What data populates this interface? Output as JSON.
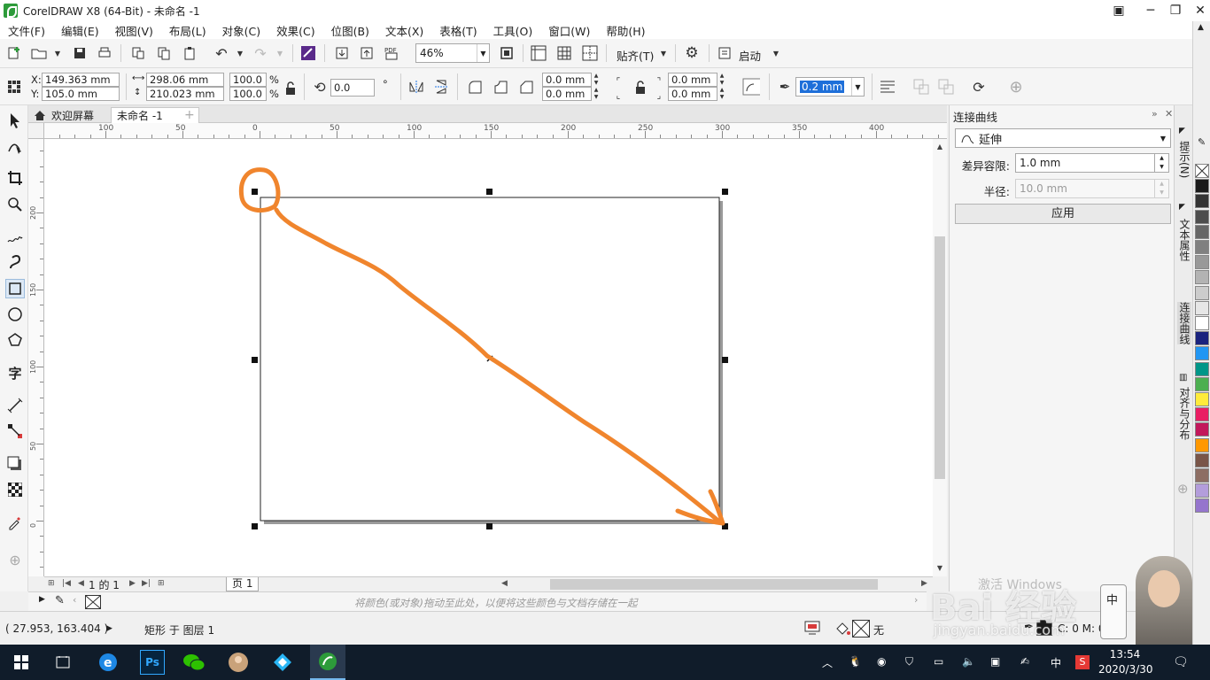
{
  "window": {
    "title": "CorelDRAW X8 (64-Bit) - 未命名 -1",
    "min": "─",
    "max": "❐",
    "close": "✕",
    "restore": "▣"
  },
  "menu": [
    "文件(F)",
    "编辑(E)",
    "视图(V)",
    "布局(L)",
    "对象(C)",
    "效果(C)",
    "位图(B)",
    "文本(X)",
    "表格(T)",
    "工具(O)",
    "窗口(W)",
    "帮助(H)"
  ],
  "toolbar": {
    "zoom": "46%",
    "snap": "贴齐(T)",
    "launch": "启动"
  },
  "property_bar": {
    "x_label": "X:",
    "x": "149.363 mm",
    "y_label": "Y:",
    "y": "105.0 mm",
    "width": "298.06 mm",
    "height": "210.023 mm",
    "scale_w": "100.0",
    "scale_h": "100.0",
    "percent": "%",
    "rotation": "0.0",
    "degree": "°",
    "corner1": "0.0 mm",
    "corner2": "0.0 mm",
    "corner3": "0.0 mm",
    "corner4": "0.0 mm",
    "outline": "0.2 mm"
  },
  "tabs": {
    "welcome": "欢迎屏幕",
    "document": "未命名 -1",
    "add": "+"
  },
  "ruler": {
    "h_labels": [
      "100",
      "50",
      "0",
      "50",
      "100",
      "150",
      "200",
      "250",
      "300",
      "350",
      "400"
    ],
    "v_labels": [
      "200",
      "150",
      "100",
      "50",
      "0"
    ]
  },
  "page_nav": {
    "page_count": "1 的 1",
    "page_tab": "页 1"
  },
  "palette_hint": "将颜色(或对象)拖动至此处，以便将这些颜色与文档存储在一起",
  "status": {
    "coords": "( 27.953, 163.404 )",
    "object": "矩形 于 图层 1",
    "fill_none": "无",
    "cmyk": "C: 0 M: 0"
  },
  "docker": {
    "title": "连接曲线",
    "mode": "延伸",
    "tolerance_label": "差异容限:",
    "tolerance": "1.0 mm",
    "radius_label": "半径:",
    "radius": "10.0 mm",
    "apply": "应用"
  },
  "docker_tabs": [
    "提示(N)",
    "文本属性",
    "连接曲线",
    "对齐与分布"
  ],
  "palette_colors": [
    "#ffffff",
    "#1a1a1a",
    "#333333",
    "#4d4d4d",
    "#666666",
    "#808080",
    "#999999",
    "#b3b3b3",
    "#cccccc",
    "#e6e6e6",
    "#ffffff",
    "#1a237e",
    "#2196f3",
    "#009688",
    "#4caf50",
    "#ffeb3b",
    "#e91e63",
    "#c2185b",
    "#ff9800",
    "#795548",
    "#8d6e63",
    "#b39ddb",
    "#9575cd"
  ],
  "annotation_color": "#f0852d",
  "taskbar": {
    "ime": "中",
    "time": "13:54",
    "date": "2020/3/30",
    "ps": "Ps"
  },
  "watermark": {
    "brand": "Bai 经验",
    "url": "jingyan.baidu.com",
    "activate": "激活 Windows"
  }
}
